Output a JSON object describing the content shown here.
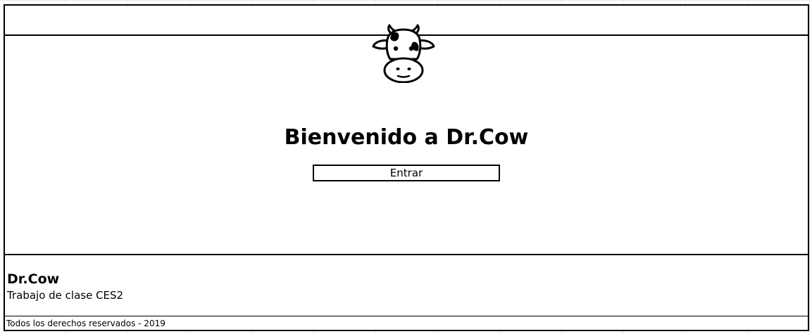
{
  "header": {
    "logo_icon": "cow-head-icon"
  },
  "main": {
    "title": "Bienvenido a Dr.Cow",
    "enter_label": "Entrar"
  },
  "footer": {
    "title": "Dr.Cow",
    "subtitle": "Trabajo de clase CES2",
    "copyright": "Todos los derechos reservados - 2019"
  }
}
